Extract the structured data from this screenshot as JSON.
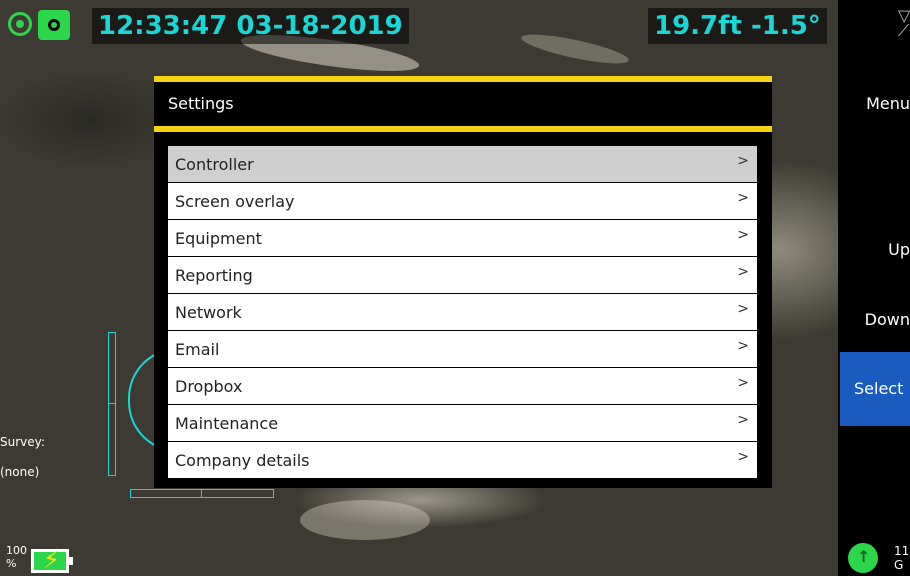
{
  "overlay": {
    "time": "12:33:47",
    "date": "03-18-2019",
    "distance": "19.7ft",
    "incline": "-1.5°",
    "survey_label": "Survey:",
    "survey_value": "(none)",
    "battery_percent": "100",
    "battery_unit": "%",
    "status_text_1": "11",
    "status_text_2": "G"
  },
  "sidebar": {
    "menu": "Menu",
    "up": "Up",
    "down": "Down",
    "select": "Select"
  },
  "dialog": {
    "title": "Settings",
    "items": [
      {
        "label": "Controller",
        "arrow": ">",
        "selected": true
      },
      {
        "label": "Screen overlay",
        "arrow": ">"
      },
      {
        "label": "Equipment",
        "arrow": ">"
      },
      {
        "label": "Reporting",
        "arrow": ">"
      },
      {
        "label": "Network",
        "arrow": ">"
      },
      {
        "label": "Email",
        "arrow": ">"
      },
      {
        "label": "Dropbox",
        "arrow": ">"
      },
      {
        "label": "Maintenance",
        "arrow": ">"
      },
      {
        "label": "Company details",
        "arrow": ">"
      }
    ]
  },
  "colors": {
    "accent_yellow": "#f5d313",
    "overlay_cyan": "#19d7d7",
    "status_green": "#2bd64a",
    "select_blue": "#1a5bbf"
  },
  "icons": [
    "camera-target-icon",
    "recording-icon",
    "battery-charging-icon",
    "signal-icon",
    "status-up-icon"
  ]
}
